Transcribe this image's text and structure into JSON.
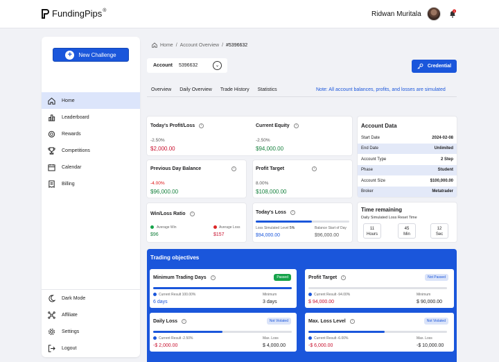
{
  "app": {
    "brand": "FundingPips",
    "brand_mark": "®"
  },
  "user": {
    "name": "Ridwan Muritala",
    "notification_count": "1"
  },
  "sidebar": {
    "new_challenge": "New Challenge",
    "items": [
      {
        "label": "Home",
        "icon": "home-icon"
      },
      {
        "label": "Leaderboard",
        "icon": "bar-chart-icon"
      },
      {
        "label": "Rewards",
        "icon": "medal-icon"
      },
      {
        "label": "Competitions",
        "icon": "trophy-icon"
      },
      {
        "label": "Calendar",
        "icon": "calendar-icon"
      },
      {
        "label": "Billing",
        "icon": "billing-icon"
      }
    ],
    "bottom_items": [
      {
        "label": "Dark Mode",
        "icon": "moon-icon"
      },
      {
        "label": "Affiliate",
        "icon": "network-icon"
      },
      {
        "label": "Settings",
        "icon": "gear-icon"
      },
      {
        "label": "Logout",
        "icon": "logout-icon"
      }
    ]
  },
  "breadcrumb": {
    "home": "Home",
    "sep1": "/",
    "overview": "Account Overview",
    "sep2": "/",
    "current": "#5396632"
  },
  "account": {
    "label": "Account",
    "value": "5396632"
  },
  "credential_button": "Credential",
  "tabs": [
    "Overview",
    "Daily Overview",
    "Trade History",
    "Statistics"
  ],
  "note": "Note: All account balances, profits, and losses are simulated",
  "stats": {
    "todays_pl": {
      "title": "Today's Profit/Loss",
      "pct": "-2.50%",
      "value": "$2,000.00"
    },
    "current_equity": {
      "title": "Current Equity",
      "pct": "-2.50%",
      "value": "$94,000.00"
    },
    "prev_day_balance": {
      "title": "Previous Day Balance",
      "pct": "-4.00%",
      "value": "$96,000.00"
    },
    "profit_target": {
      "title": "Profit Target",
      "pct": "8.00%",
      "value": "$108,000.00"
    },
    "win_loss": {
      "title": "Win/Loss Ratio",
      "avg_win_label": "Average Win",
      "avg_win": "$96",
      "avg_loss_label": "Average Loss",
      "avg_loss": "$157"
    },
    "todays_loss": {
      "title": "Today's Loss",
      "progress": 0.6,
      "limit_label": "Loss Simulated Level",
      "limit_pct": "5%",
      "limit_value": "$94,000.00",
      "start_label": "Balance Start of Day",
      "start_value": "$96,000.00"
    }
  },
  "account_data": {
    "title": "Account Data",
    "rows": [
      {
        "k": "Start Date",
        "v": "2024-02-08"
      },
      {
        "k": "End Date",
        "v": "Unlimited"
      },
      {
        "k": "Account Type",
        "v": "2 Step"
      },
      {
        "k": "Phase",
        "v": "Student"
      },
      {
        "k": "Account Size",
        "v": "$100,000.00"
      },
      {
        "k": "Broker",
        "v": "Metatrader"
      }
    ]
  },
  "time_remaining": {
    "title": "Time remaining",
    "subtitle": "Daily Simulated Loss Reset Time",
    "hours": "11",
    "hours_label": "Hours",
    "mins": "45",
    "mins_label": "Min",
    "secs": "12",
    "secs_label": "Sec"
  },
  "objectives": {
    "title": "Trading objectives",
    "items": [
      {
        "title": "Minimum Trading Days",
        "badge": "Passed",
        "progress": 1.0,
        "current_label": "Current Result 100.00%",
        "current_value": "6 days",
        "min_label": "Minimum",
        "min_value": "3 days"
      },
      {
        "title": "Profit Target",
        "badge": "Not Passed",
        "progress": 0.0,
        "current_label": "Current Result -94.00%",
        "current_value": "$ 94,000.00",
        "min_label": "Minimum",
        "min_value": "$ 90,000.00"
      },
      {
        "title": "Daily Loss",
        "badge": "Not Violated",
        "progress": 0.5,
        "current_label": "Current Result -2.50%",
        "current_value": "-$ 2,000.00",
        "min_label": "Max. Loss",
        "min_value": "$ 4,000.00"
      },
      {
        "title": "Max. Loss Level",
        "badge": "Not Violated",
        "progress": 0.55,
        "current_label": "Current Result -6.00%",
        "current_value": "-$ 6,000.00",
        "min_label": "Max. Loss",
        "min_value": "-$ 10,000.00"
      }
    ]
  }
}
